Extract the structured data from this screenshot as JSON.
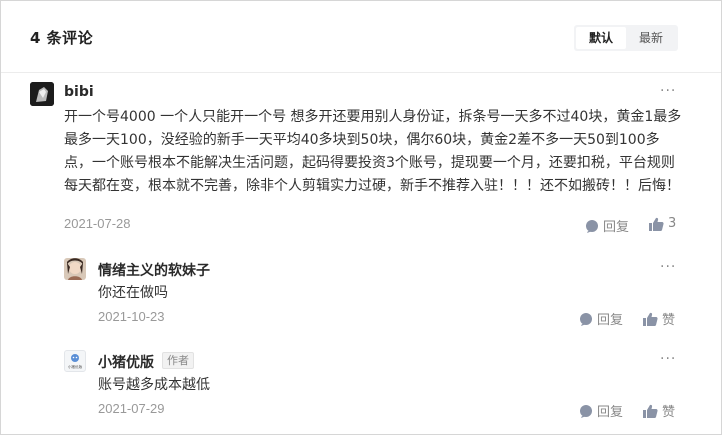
{
  "header": {
    "count_title": "4 条评论",
    "sort_default": "默认",
    "sort_latest": "最新"
  },
  "comments": [
    {
      "user": "bibi",
      "text": "开一个号4000 一个人只能开一个号 想多开还要用别人身份证，拆条号一天多不过40块，黄金1最多最多一天100，没经验的新手一天平均40多块到50块，偶尔60块，黄金2差不多一天50到100多点，一个账号根本不能解决生活问题，起码得要投资3个账号，提现要一个月，还要扣税，平台规则每天都在变，根本就不完善，除非个人剪辑实力过硬，新手不推荐入驻！！！还不如搬砖！！后悔！",
      "date": "2021-07-28",
      "reply_label": "回复",
      "like_count": "3"
    }
  ],
  "replies": [
    {
      "user": "情绪主义的软妹子",
      "text": "你还在做吗",
      "date": "2021-10-23",
      "reply_label": "回复",
      "like_label": "赞"
    },
    {
      "user": "小猪优版",
      "tag": "作者",
      "avatar_text": "小猪优版",
      "text": "账号越多成本越低",
      "date": "2021-07-29",
      "reply_label": "回复",
      "like_label": "赞"
    }
  ]
}
